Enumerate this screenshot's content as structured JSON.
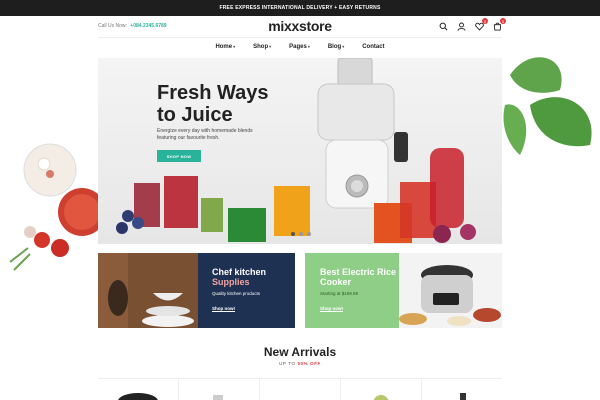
{
  "topbar": {
    "text": "FREE EXPRESS INTERNATIONAL DELIVERY + EASY RETURNS"
  },
  "header": {
    "call_label": "Call Us Now:",
    "phone": "+084.2345.6789",
    "logo": "mixxstore",
    "wishlist_count": "0",
    "cart_count": "0"
  },
  "nav": {
    "items": [
      "Home",
      "Shop",
      "Pages",
      "Blog",
      "Contact"
    ]
  },
  "hero": {
    "title_line1": "Fresh Ways",
    "title_line2": "to Juice",
    "text": "Energize every day with homemade blends featuring our favourite fresh.",
    "button": "SHOP NOW"
  },
  "banners": [
    {
      "title": "Chef kitchen",
      "title_accent": "Supplies",
      "subtitle": "Quality kitchen products",
      "link": "Shop now!"
    },
    {
      "title": "Best Electric Rice Cooker",
      "subtitle": "Starting at $199.99",
      "link": "Shop now!"
    }
  ],
  "new_arrivals": {
    "title": "New Arrivals",
    "subtitle_prefix": "UP TO",
    "subtitle_highlight": "50% OFF"
  },
  "colors": {
    "accent": "#2ab39b",
    "badge": "#e23b3b",
    "navy": "#1f3152",
    "green": "#8fce86"
  }
}
